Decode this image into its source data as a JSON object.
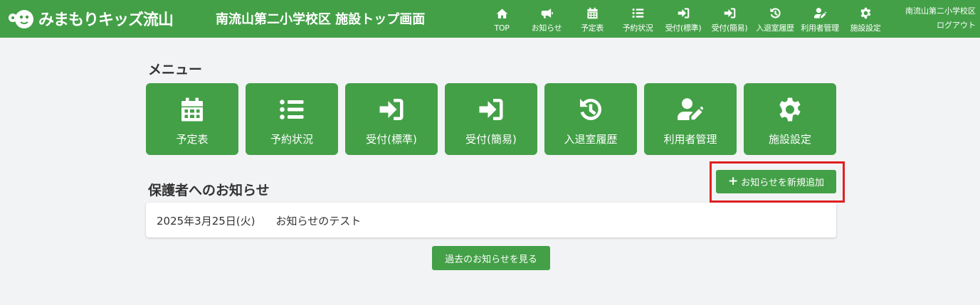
{
  "header": {
    "logo_text": "みまもりキッズ流山",
    "page_title": "南流山第二小学校区 施設トップ画面",
    "nav": [
      {
        "label": "TOP",
        "icon": "home-icon"
      },
      {
        "label": "お知らせ",
        "icon": "megaphone-icon"
      },
      {
        "label": "予定表",
        "icon": "calendar-icon"
      },
      {
        "label": "予約状況",
        "icon": "list-icon"
      },
      {
        "label": "受付(標準)",
        "icon": "sign-in-icon"
      },
      {
        "label": "受付(簡易)",
        "icon": "sign-in-icon"
      },
      {
        "label": "入退室履歴",
        "icon": "history-icon"
      },
      {
        "label": "利用者管理",
        "icon": "user-edit-icon"
      },
      {
        "label": "施設設定",
        "icon": "gear-icon"
      }
    ],
    "user_name": "南流山第二小学校区",
    "logout_label": "ログアウト"
  },
  "menu": {
    "title": "メニュー",
    "items": [
      {
        "label": "予定表",
        "icon": "calendar-icon"
      },
      {
        "label": "予約状況",
        "icon": "list-icon"
      },
      {
        "label": "受付(標準)",
        "icon": "sign-in-icon"
      },
      {
        "label": "受付(簡易)",
        "icon": "sign-in-icon"
      },
      {
        "label": "入退室履歴",
        "icon": "history-icon"
      },
      {
        "label": "利用者管理",
        "icon": "user-edit-icon"
      },
      {
        "label": "施設設定",
        "icon": "gear-icon"
      }
    ]
  },
  "notices": {
    "title": "保護者へのお知らせ",
    "add_button_label": "お知らせを新規追加",
    "items": [
      {
        "date": "2025年3月25日(火)",
        "title": "お知らせのテスト"
      }
    ],
    "past_button_label": "過去のお知らせを見る"
  },
  "colors": {
    "brand_green": "#43a047",
    "highlight_red": "#e02020",
    "background": "#f2f3f5"
  }
}
